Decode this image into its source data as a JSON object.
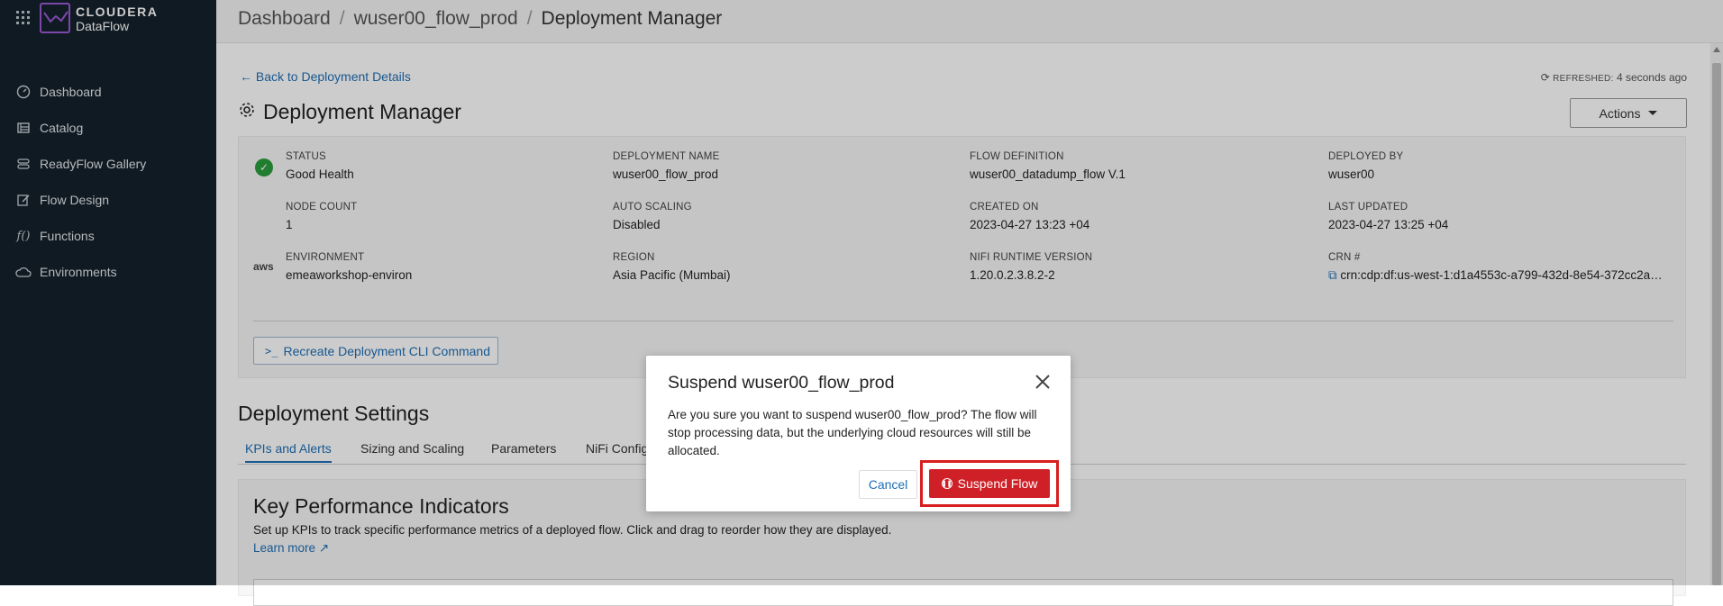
{
  "brand": {
    "line1": "CLOUDERA",
    "line2": "DataFlow",
    "accent": "#9b59d6"
  },
  "sidebar": {
    "items": [
      {
        "label": "Dashboard",
        "icon": "gauge-icon"
      },
      {
        "label": "Catalog",
        "icon": "catalog-icon"
      },
      {
        "label": "ReadyFlow Gallery",
        "icon": "readyflow-icon"
      },
      {
        "label": "Flow Design",
        "icon": "flow-design-icon"
      },
      {
        "label": "Functions",
        "icon": "functions-icon"
      },
      {
        "label": "Environments",
        "icon": "cloud-icon"
      }
    ]
  },
  "breadcrumb": [
    "Dashboard",
    "wuser00_flow_prod",
    "Deployment Manager"
  ],
  "back_link": "Back to Deployment Details",
  "refreshed": {
    "label": "REFRESHED:",
    "value": "4 seconds ago"
  },
  "page_title": "Deployment Manager",
  "actions_label": "Actions",
  "fields": {
    "status": {
      "label": "STATUS",
      "value": "Good Health"
    },
    "deployment_name": {
      "label": "DEPLOYMENT NAME",
      "value": "wuser00_flow_prod"
    },
    "flow_definition": {
      "label": "FLOW DEFINITION",
      "value": "wuser00_datadump_flow V.1"
    },
    "deployed_by": {
      "label": "DEPLOYED BY",
      "value": "wuser00"
    },
    "node_count": {
      "label": "NODE COUNT",
      "value": "1"
    },
    "auto_scaling": {
      "label": "AUTO SCALING",
      "value": "Disabled"
    },
    "created_on": {
      "label": "CREATED ON",
      "value": "2023-04-27 13:23 +04"
    },
    "last_updated": {
      "label": "LAST UPDATED",
      "value": "2023-04-27 13:25 +04"
    },
    "environment": {
      "label": "ENVIRONMENT",
      "value": "emeaworkshop-environ"
    },
    "region": {
      "label": "REGION",
      "value": "Asia Pacific (Mumbai)"
    },
    "nifi_runtime": {
      "label": "NIFI RUNTIME VERSION",
      "value": "1.20.0.2.3.8.2-2"
    },
    "crn": {
      "label": "CRN #",
      "value": "crn:cdp:df:us-west-1:d1a4553c-a799-432d-8e54-372cc2a…"
    }
  },
  "aws_label": "aws",
  "cli_button": "Recreate Deployment CLI Command",
  "settings_title": "Deployment Settings",
  "tabs": [
    "KPIs and Alerts",
    "Sizing and Scaling",
    "Parameters",
    "NiFi Config"
  ],
  "kpi": {
    "title": "Key Performance Indicators",
    "description": "Set up KPIs to track specific performance metrics of a deployed flow. Click and drag to reorder how they are displayed.",
    "learn_more": "Learn more"
  },
  "modal": {
    "title": "Suspend wuser00_flow_prod",
    "body": "Are you sure you want to suspend wuser00_flow_prod? The flow will stop processing data, but the underlying cloud resources will still be allocated.",
    "cancel": "Cancel",
    "confirm": "Suspend Flow"
  },
  "colors": {
    "sidebar_bg": "#14212b",
    "link": "#1f6fb6",
    "danger": "#cf2027",
    "success": "#2a9d3c",
    "highlight": "#d81e1e"
  }
}
